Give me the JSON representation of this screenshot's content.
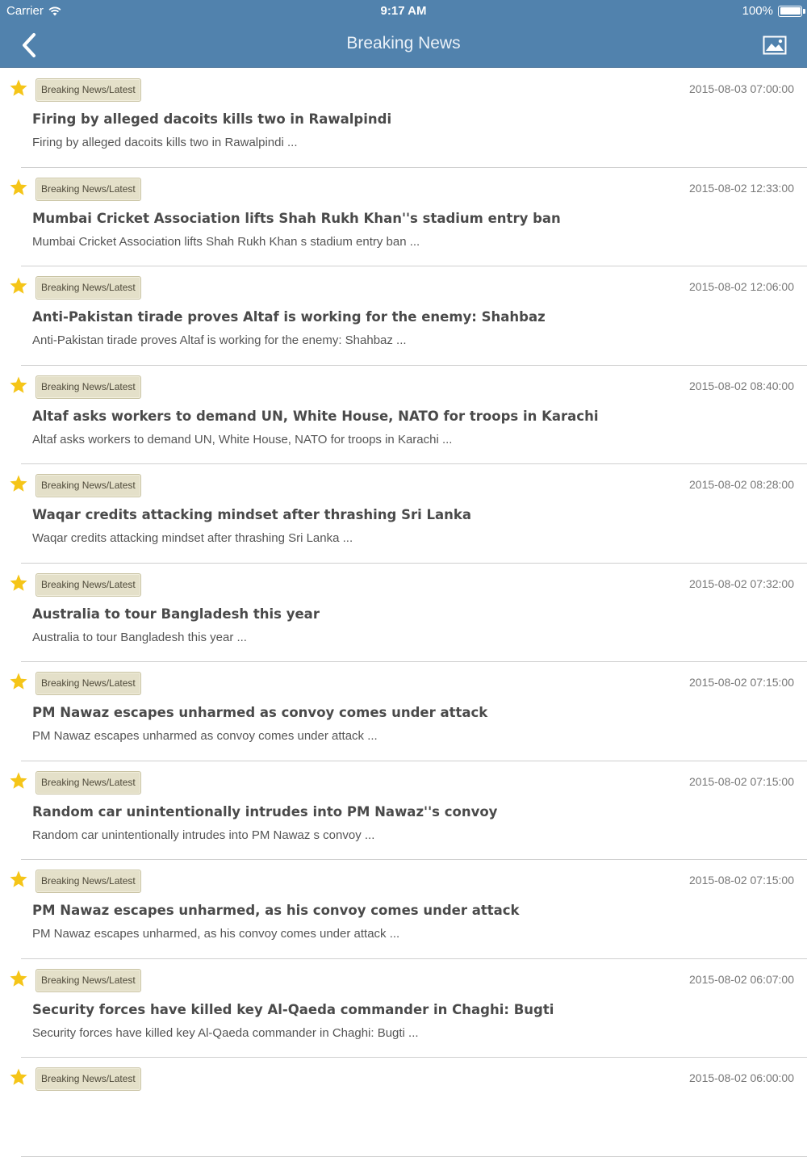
{
  "colors": {
    "accent": "#5182ad",
    "star": "#f5c518",
    "badge_bg": "#e4e0c9"
  },
  "status_bar": {
    "carrier": "Carrier",
    "time": "9:17 AM",
    "battery": "100%"
  },
  "nav": {
    "title": "Breaking News",
    "back_icon": "chevron-left-icon",
    "right_icon": "image-icon"
  },
  "news": [
    {
      "category": "Breaking News/Latest",
      "date": "2015-08-03 07:00:00",
      "title": "Firing by alleged dacoits kills two in Rawalpindi",
      "summary": "Firing by alleged dacoits kills two in Rawalpindi ..."
    },
    {
      "category": "Breaking News/Latest",
      "date": "2015-08-02 12:33:00",
      "title": "Mumbai Cricket Association lifts Shah Rukh Khan''s stadium entry ban",
      "summary": "Mumbai Cricket Association lifts Shah Rukh Khan s stadium entry ban ..."
    },
    {
      "category": "Breaking News/Latest",
      "date": "2015-08-02 12:06:00",
      "title": "Anti-Pakistan tirade proves Altaf is working for the enemy: Shahbaz",
      "summary": "Anti-Pakistan tirade proves Altaf is working for the enemy: Shahbaz ..."
    },
    {
      "category": "Breaking News/Latest",
      "date": "2015-08-02 08:40:00",
      "title": "Altaf asks workers to demand UN, White House, NATO for troops in Karachi",
      "summary": "Altaf asks workers to demand UN, White House, NATO for troops in Karachi ..."
    },
    {
      "category": "Breaking News/Latest",
      "date": "2015-08-02 08:28:00",
      "title": "Waqar credits attacking mindset after thrashing Sri Lanka",
      "summary": "Waqar credits attacking mindset after thrashing Sri Lanka ..."
    },
    {
      "category": "Breaking News/Latest",
      "date": "2015-08-02 07:32:00",
      "title": "Australia to tour Bangladesh this year",
      "summary": "Australia to tour Bangladesh this year ..."
    },
    {
      "category": "Breaking News/Latest",
      "date": "2015-08-02 07:15:00",
      "title": "PM Nawaz escapes unharmed as convoy comes under attack",
      "summary": "PM Nawaz escapes unharmed as convoy comes under attack ..."
    },
    {
      "category": "Breaking News/Latest",
      "date": "2015-08-02 07:15:00",
      "title": "Random car unintentionally intrudes into PM Nawaz''s convoy",
      "summary": "Random car unintentionally intrudes into PM Nawaz s convoy ..."
    },
    {
      "category": "Breaking News/Latest",
      "date": "2015-08-02 07:15:00",
      "title": "PM Nawaz escapes unharmed, as his convoy comes under attack",
      "summary": "PM Nawaz escapes unharmed, as his convoy comes under attack ..."
    },
    {
      "category": "Breaking News/Latest",
      "date": "2015-08-02 06:07:00",
      "title": "Security forces have killed key Al-Qaeda commander in Chaghi: Bugti",
      "summary": "Security forces have killed key Al-Qaeda commander in Chaghi: Bugti ..."
    },
    {
      "category": "Breaking News/Latest",
      "date": "2015-08-02 06:00:00",
      "title": "",
      "summary": ""
    }
  ]
}
